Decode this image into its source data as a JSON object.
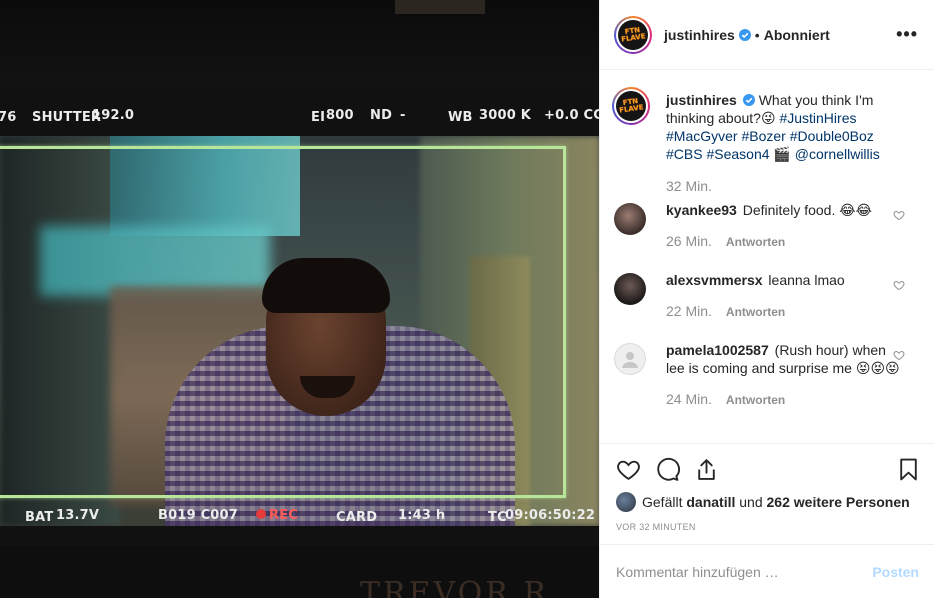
{
  "photo": {
    "hud_top": {
      "left_edge": "76",
      "shutter_label": "SHUTTER",
      "shutter_value": "192.0",
      "ei_label": "EI",
      "ei_value": "800",
      "nd_label": "ND",
      "nd_value": "-",
      "wb_label": "WB",
      "wb_value": "3000 K",
      "tint": "+0.0 CC"
    },
    "hud_bottom": {
      "bat_label": "BAT",
      "bat_value": "13.7V",
      "clip": "B019 C007",
      "rec": "REC",
      "card_label": "CARD",
      "card_value": "1:43 h",
      "tc_label": "TC",
      "tc_value": "09:06:50:22"
    },
    "stand_text": "TREVOR R",
    "guide_color": "#b7e59a"
  },
  "header": {
    "username": "justinhires",
    "separator": "•",
    "follow_status": "Abonniert",
    "avatar_logo": "FTN FLAVE"
  },
  "caption": {
    "username": "justinhires",
    "text": "What you think I'm thinking about?😜",
    "tags": [
      "#JustinHires",
      "#MacGyver",
      "#Bozer",
      "#Double0Boz",
      "#CBS",
      "#Season4",
      "🎬",
      "@cornellwillis"
    ],
    "time": "32 Min."
  },
  "comments": [
    {
      "username": "kyankee93",
      "text": "Definitely food. 😂😂",
      "time": "26 Min.",
      "reply": "Antworten",
      "avatar_color": "#3b2d2a"
    },
    {
      "username": "alexsvmmersx",
      "text": "leanna lmao",
      "time": "22 Min.",
      "reply": "Antworten",
      "avatar_color": "#2a2a2a"
    },
    {
      "username": "pamela1002587",
      "text": "(Rush hour) when lee is coming and surprise me 😝😝😝",
      "time": "24 Min.",
      "reply": "Antworten",
      "avatar_color": "#dbdbdb"
    }
  ],
  "likes": {
    "prefix": "Gefällt",
    "user": "danatill",
    "middle": "und",
    "count_text": "262 weitere Personen"
  },
  "timeago": "VOR 32 MINUTEN",
  "comment_box": {
    "placeholder": "Kommentar hinzufügen …",
    "post_label": "Posten"
  },
  "colors": {
    "link": "#003569",
    "muted": "#8e8e8e",
    "text": "#262626",
    "post_disabled": "#b3dbff",
    "verified": "#3897f0"
  }
}
